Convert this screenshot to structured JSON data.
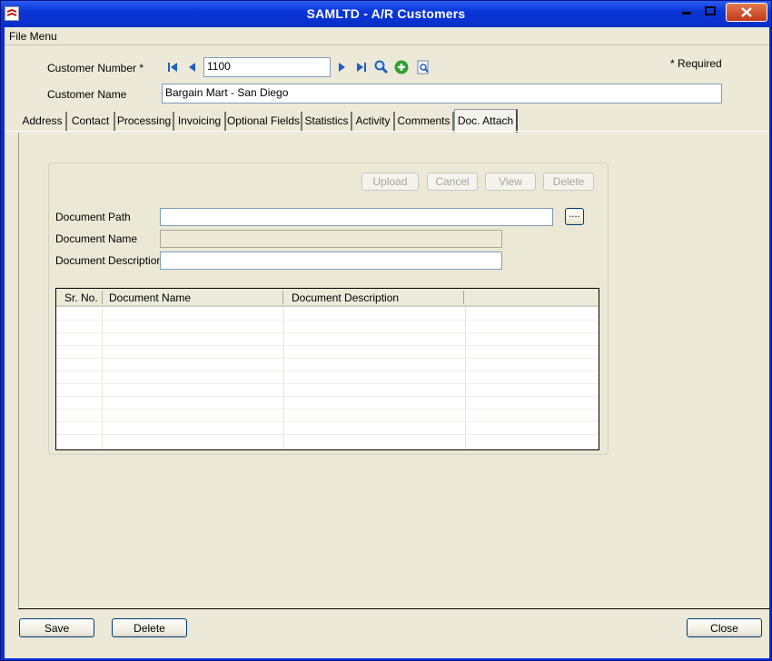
{
  "window": {
    "title": "SAMLTD - A/R Customers"
  },
  "menu": {
    "file_menu": "File Menu"
  },
  "header": {
    "customer_number_label": "Customer Number *",
    "customer_number_value": "1100",
    "customer_name_label": "Customer Name",
    "customer_name_value": "Bargain Mart - San Diego",
    "required_note": "*  Required"
  },
  "tabs": [
    {
      "label": "Address"
    },
    {
      "label": "Contact"
    },
    {
      "label": "Processing"
    },
    {
      "label": "Invoicing"
    },
    {
      "label": "Optional Fields"
    },
    {
      "label": "Statistics"
    },
    {
      "label": "Activity"
    },
    {
      "label": "Comments"
    },
    {
      "label": "Doc. Attach"
    }
  ],
  "active_tab": "Doc. Attach",
  "doc_attach": {
    "buttons": {
      "upload": "Upload",
      "cancel": "Cancel",
      "view": "View",
      "delete": "Delete"
    },
    "document_path_label": "Document Path",
    "document_path_value": "",
    "browse_button": "....",
    "document_name_label": "Document Name",
    "document_name_value": "",
    "document_description_label": "Document Description",
    "document_description_value": "",
    "grid": {
      "columns": [
        "Sr. No.",
        "Document Name",
        "Document Description",
        ""
      ],
      "rows": []
    }
  },
  "footer": {
    "save": "Save",
    "delete": "Delete",
    "close": "Close"
  },
  "colors": {
    "titlebar": "#0a35d8",
    "window_bg": "#ece9d8",
    "accent_green": "#2ea12e"
  }
}
